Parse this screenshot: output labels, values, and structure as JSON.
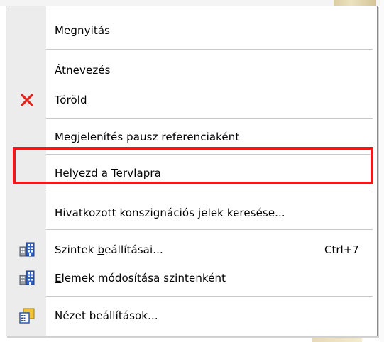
{
  "menu": {
    "items": [
      {
        "label": "Megnyitás"
      },
      {
        "label": "Átnevezés"
      },
      {
        "label": "Töröld",
        "icon": "delete-x-icon",
        "icon_color": "#e0261c"
      },
      {
        "label": "Megjelenítés pausz referenciaként"
      },
      {
        "label": "Helyezd a Tervlapra",
        "highlighted": true,
        "highlight_color": "#e81c1c"
      },
      {
        "label": "Hivatkozott konszignációs jelek keresése..."
      },
      {
        "label_prefix": "Szintek ",
        "label_accel": "b",
        "label_suffix": "eállításai...",
        "shortcut": "Ctrl+7",
        "icon": "story-settings-icon"
      },
      {
        "label_accel": "E",
        "label_suffix": "lemek módosítása szintenként",
        "icon": "story-elements-icon"
      },
      {
        "label": "Nézet beállítások...",
        "icon": "view-settings-icon"
      }
    ]
  }
}
